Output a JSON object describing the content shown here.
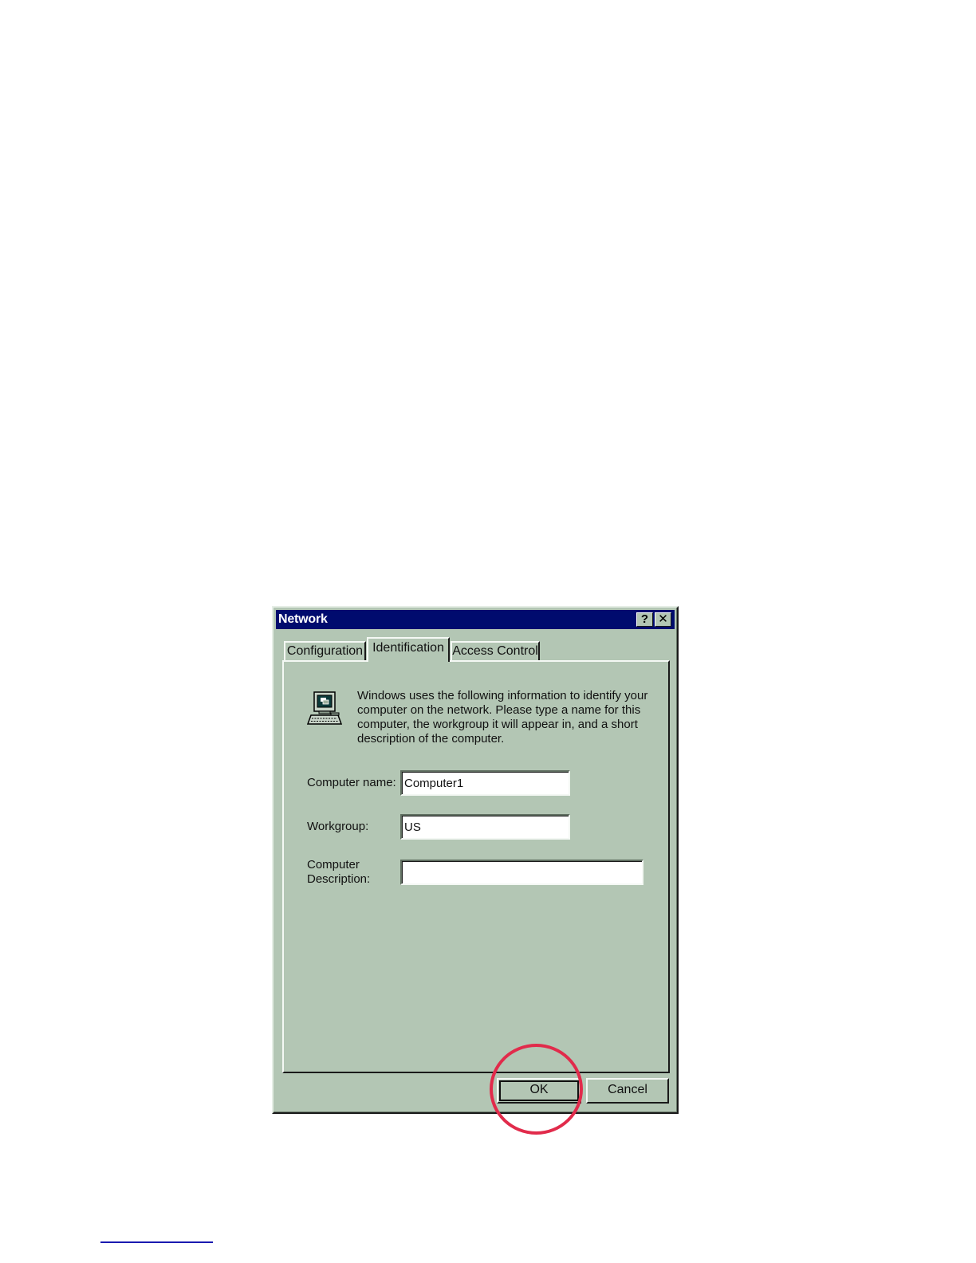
{
  "window": {
    "title": "Network",
    "help_glyph": "?",
    "close_glyph": "✕"
  },
  "tabs": [
    {
      "label": "Configuration",
      "active": false
    },
    {
      "label": "Identification",
      "active": true
    },
    {
      "label": "Access Control",
      "active": false
    }
  ],
  "panel": {
    "icon": "computer-icon",
    "info_text": "Windows uses the following information to identify your computer on the network.  Please type a name for this computer, the workgroup it will appear in, and a short description of the computer.",
    "computer_name": {
      "label": "Computer name:",
      "value": "Computer1"
    },
    "workgroup": {
      "label": "Workgroup:",
      "value": "US"
    },
    "description": {
      "label_line1": "Computer",
      "label_line2": "Description:",
      "value": ""
    }
  },
  "buttons": {
    "ok": "OK",
    "cancel": "Cancel"
  },
  "annotation": {
    "circle_color": "#e12b4b",
    "target": "OK button"
  },
  "colors": {
    "titlebar": "#000b6e",
    "dialog_face": "#b3c6b4"
  }
}
